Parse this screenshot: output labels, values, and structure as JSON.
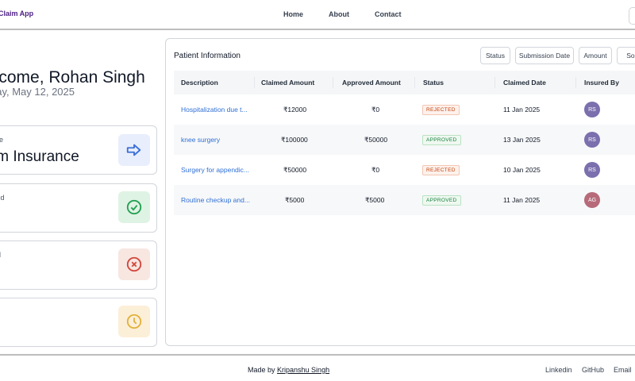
{
  "header": {
    "brand": "Claim App",
    "nav": {
      "home": "Home",
      "about": "About",
      "contact": "Contact"
    }
  },
  "welcome": {
    "greeting": "elcome, Rohan Singh",
    "date": "day, May 12, 2025"
  },
  "cards": [
    {
      "label": "ere",
      "value": "im Insurance",
      "icon": "arrow-right-icon",
      "bg": "#e8eefb",
      "color": "#3b6fd8"
    },
    {
      "label": "ved",
      "value": "",
      "icon": "check-circle-icon",
      "bg": "#dff3e4",
      "color": "#22a052"
    },
    {
      "label": "ed",
      "value": "",
      "icon": "x-circle-icon",
      "bg": "#f8e6e1",
      "color": "#d3463b"
    },
    {
      "label": "g",
      "value": "",
      "icon": "clock-icon",
      "bg": "#fcefd8",
      "color": "#e2b13c"
    }
  ],
  "table": {
    "title": "Patient Information",
    "filters": [
      "Status",
      "Submission Date",
      "Amount",
      "Sort"
    ],
    "columns": [
      "Description",
      "Claimed Amount",
      "Approved Amount",
      "Status",
      "Claimed Date",
      "Insured By"
    ],
    "rows": [
      {
        "description": "Hospitalization due t...",
        "claimed": "₹12000",
        "approved": "₹0",
        "status": "REJECTED",
        "date": "11 Jan 2025",
        "insured": "RS",
        "avatar_color": "#7b6fae"
      },
      {
        "description": "knee surgery",
        "claimed": "₹100000",
        "approved": "₹50000",
        "status": "APPROVED",
        "date": "13 Jan 2025",
        "insured": "RS",
        "avatar_color": "#7b6fae"
      },
      {
        "description": "Surgery for appendic...",
        "claimed": "₹50000",
        "approved": "₹0",
        "status": "REJECTED",
        "date": "10 Jan 2025",
        "insured": "RS",
        "avatar_color": "#7b6fae"
      },
      {
        "description": "Routine checkup and...",
        "claimed": "₹5000",
        "approved": "₹5000",
        "status": "APPROVED",
        "date": "11 Jan 2025",
        "insured": "AG",
        "avatar_color": "#b66a7a"
      }
    ]
  },
  "footer": {
    "made_prefix": "Made by ",
    "author": "Kripanshu Singh",
    "links": [
      "Linkedin",
      "GitHub",
      "Email"
    ]
  }
}
